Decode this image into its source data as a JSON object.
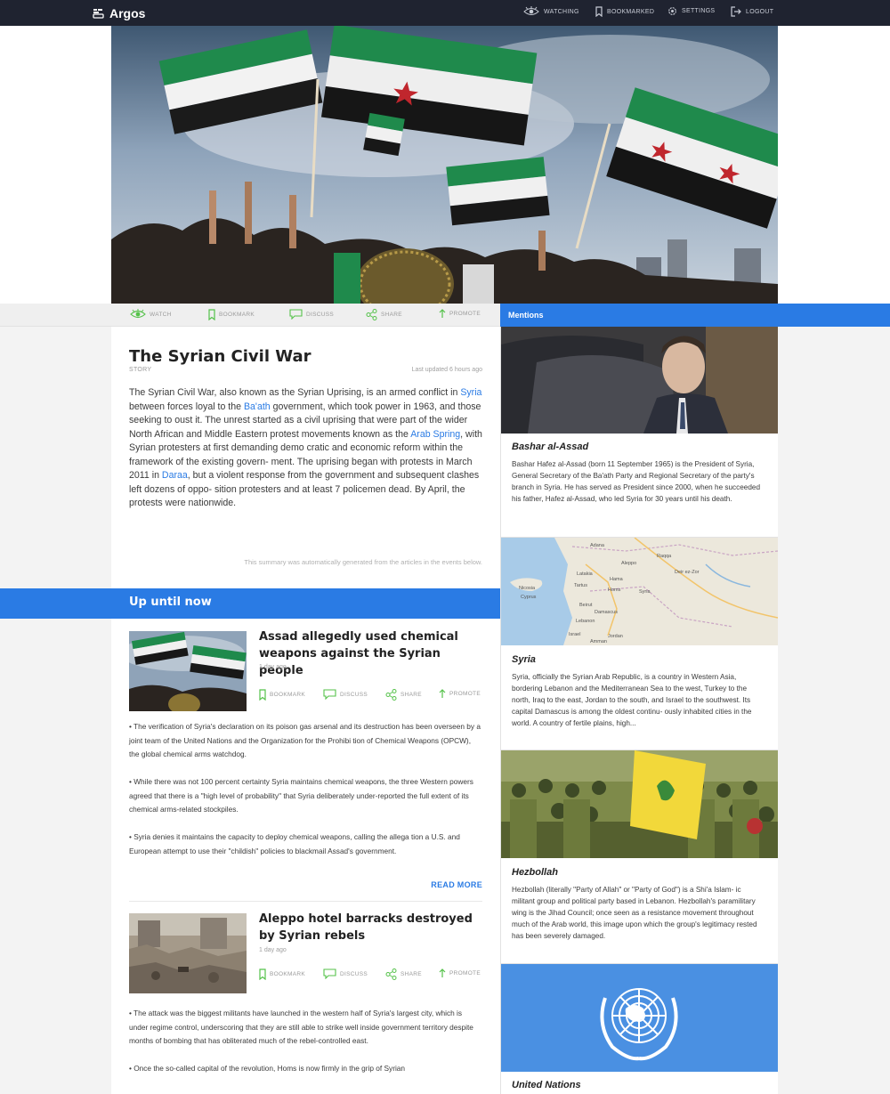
{
  "app": {
    "name": "Argos"
  },
  "nav": {
    "watching": "Watching",
    "bookmarked": "Bookmarked",
    "settings": "Settings",
    "logout": "Logout"
  },
  "actions": {
    "watch": "Watch",
    "bookmark": "Bookmark",
    "discuss": "Discuss",
    "share": "Share",
    "promote": "Promote"
  },
  "story": {
    "title": "The Syrian Civil War",
    "kind": "Story",
    "updated": "Last updated 6 hours ago",
    "summary": {
      "p1": "The Syrian Civil War, also known as the Syrian Uprising, is an armed conflict in ",
      "link1": "Syria",
      "p2": " between forces loyal to the ",
      "link2": "Ba'ath",
      "p3": " government, which took power in 1963, and those seeking to oust it. The unrest started as a civil uprising that were part of the wider North African and Middle Eastern protest movements known as the ",
      "link3": "Arab Spring",
      "p4": ", with Syrian protesters at first demanding demo cratic and economic reform within the framework of the existing govern- ment. The uprising began with protests in March 2011 in ",
      "link4": "Daraa",
      "p5": ", but a violent response from the government and subsequent clashes left dozens of oppo- sition protesters and at least 7 policemen dead. By April, the protests were nationwide."
    },
    "auto_note": "This summary was automatically generated from the articles in the events below."
  },
  "up_until_now": {
    "heading": "Up until now",
    "read_more": "Read More",
    "events": [
      {
        "title": "Assad allegedly used chemical weapons against the Syrian people",
        "age": "1 day ago",
        "bullets": [
          "• The verification of Syria's declaration on its poison gas arsenal and its destruction has been overseen by a joint team of the United Nations and the Organization for the Prohibi tion of Chemical Weapons (OPCW), the global chemical arms watchdog.",
          "• While there was not 100 percent certainty Syria maintains chemical weapons, the three Western powers agreed that there is a \"high level of probability\" that Syria deliberately under-reported the full extent of its chemical arms-related stockpiles.",
          "• Syria denies it maintains the capacity to deploy chemical weapons, calling the allega tion a U.S. and European attempt to use their \"childish\" policies to blackmail Assad's government."
        ]
      },
      {
        "title": "Aleppo hotel barracks destroyed by Syrian rebels",
        "age": "1 day ago",
        "bullets": [
          "• The attack was the biggest militants have launched in the western half of Syria's largest city, which is under regime control, underscoring that they are still able to strike well inside government territory despite months of bombing that has obliterated much of the rebel-controlled east.",
          "• Once the so-called capital of the revolution, Homs is now firmly in the grip of Syrian"
        ]
      }
    ]
  },
  "mentions": {
    "heading": "Mentions",
    "items": [
      {
        "name": "Bashar al-Assad",
        "desc": "Bashar Hafez al-Assad (born 11 September 1965) is the President of Syria, General Secretary of the Ba'ath Party and Regional Secretary of the party's branch in Syria. He has served as President since 2000, when he succeeded his father, Hafez al-Assad, who led Syria for 30 years until his death."
      },
      {
        "name": "Syria",
        "desc": "Syria, officially the Syrian Arab Republic, is a country in Western Asia, bordering Lebanon and the Mediterranean Sea to the west, Turkey to the north, Iraq to the east, Jordan to the south, and Israel to the southwest. Its capital Damascus is among the oldest continu- ously inhabited cities in the world. A country of fertile plains, high...",
        "map_labels": [
          "Adana",
          "Aleppo",
          "Latakia",
          "Hama",
          "Homs",
          "Syria",
          "Beirut",
          "Damascus",
          "Deir ez-Zor",
          "Raqqa",
          "Tartus",
          "Lebanon",
          "Israel",
          "Jordan",
          "Nicosia",
          "Cyprus",
          "Amman"
        ]
      },
      {
        "name": "Hezbollah",
        "desc": "Hezbollah (literally \"Party of Allah\" or \"Party of God\") is a Shi'a Islam- ic militant group and political party based in Lebanon. Hezbollah's paramilitary wing is the Jihad Council; once seen as a resistance movement throughout much of the Arab world, this image upon which the group's legitimacy rested has been severely damaged."
      },
      {
        "name": "United Nations",
        "desc": ""
      }
    ]
  },
  "colors": {
    "topbar": "#1f2330",
    "accent": "#2a7be4",
    "watch_green": "#55c24a"
  }
}
